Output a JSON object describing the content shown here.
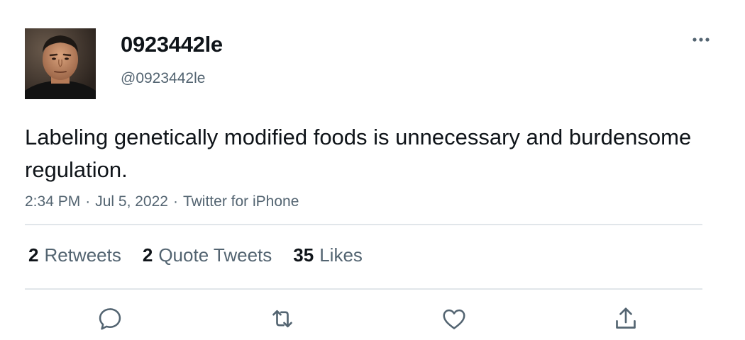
{
  "tweet": {
    "display_name": "0923442le",
    "handle": "@0923442le",
    "text": "Labeling genetically modified foods is unnecessary and burdensome regulation.",
    "time": "2:34 PM",
    "date": "Jul 5, 2022",
    "source": "Twitter for iPhone",
    "separator": "·"
  },
  "stats": {
    "retweets_count": "2",
    "retweets_label": "Retweets",
    "quotes_count": "2",
    "quotes_label": "Quote Tweets",
    "likes_count": "35",
    "likes_label": "Likes"
  },
  "icons": {
    "more": "more-horizontal-icon",
    "reply": "reply-icon",
    "retweet": "retweet-icon",
    "like": "heart-icon",
    "share": "share-icon"
  },
  "colors": {
    "text_primary": "#0f1419",
    "text_secondary": "#536471",
    "divider": "#e1e6ea",
    "icon": "#536471"
  }
}
